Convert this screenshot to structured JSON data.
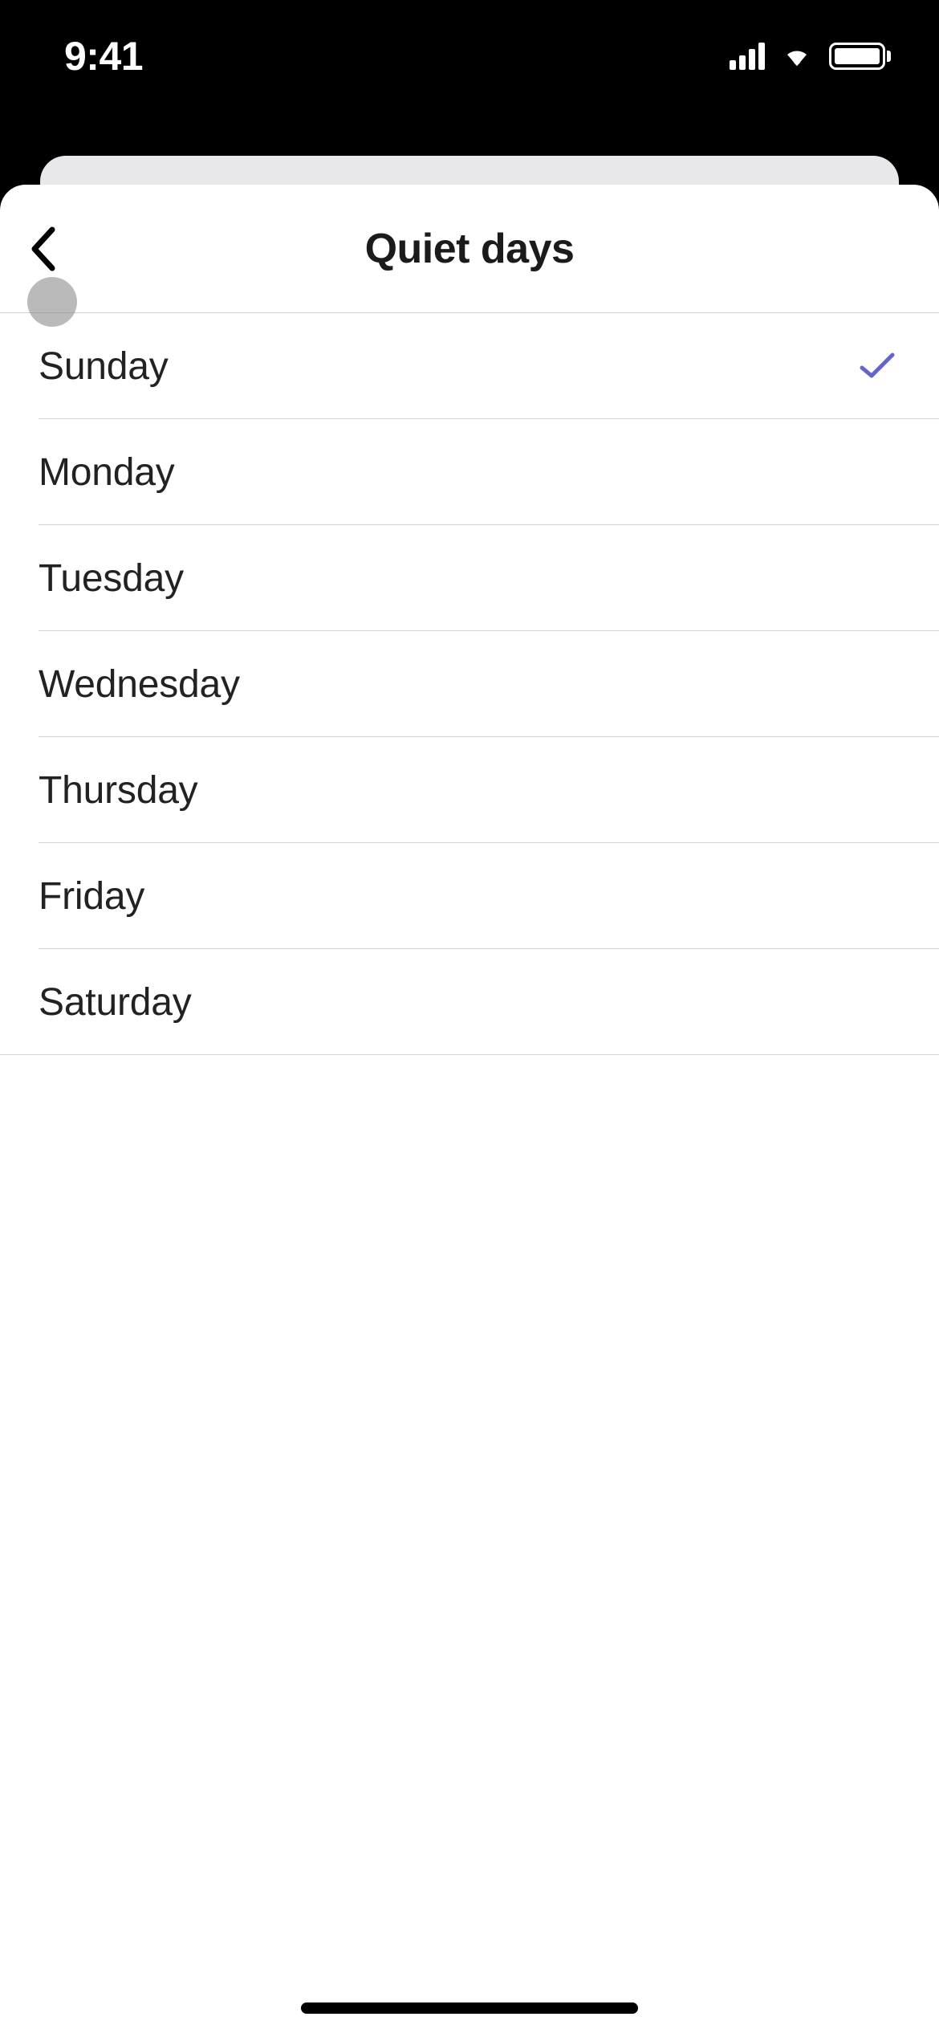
{
  "status": {
    "time": "9:41"
  },
  "nav": {
    "title": "Quiet days"
  },
  "days": [
    {
      "label": "Sunday",
      "selected": true
    },
    {
      "label": "Monday",
      "selected": false
    },
    {
      "label": "Tuesday",
      "selected": false
    },
    {
      "label": "Wednesday",
      "selected": false
    },
    {
      "label": "Thursday",
      "selected": false
    },
    {
      "label": "Friday",
      "selected": false
    },
    {
      "label": "Saturday",
      "selected": false
    }
  ],
  "colors": {
    "check": "#6365c9"
  }
}
